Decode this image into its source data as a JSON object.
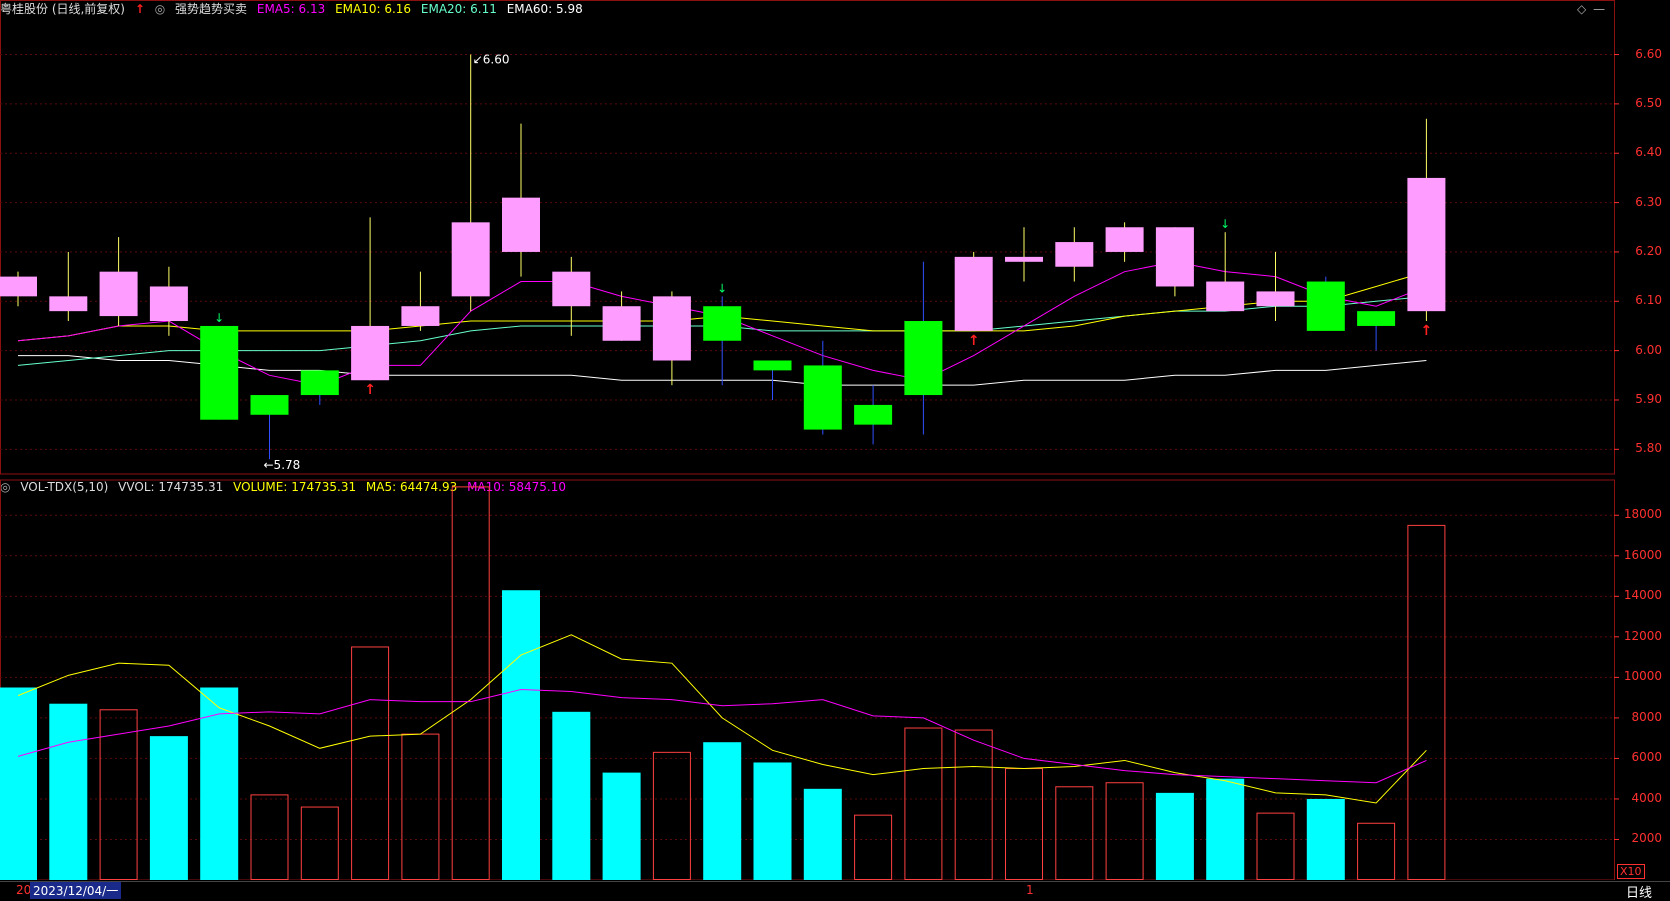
{
  "header": {
    "stock_name": "粤桂股份 (日线,前复权)",
    "indicator_name": "强势趋势买卖",
    "ema5": "EMA5: 6.13",
    "ema10": "EMA10: 6.16",
    "ema20": "EMA20: 6.11",
    "ema60": "EMA60: 5.98",
    "icons": [
      "diamond-icon",
      "minimize-icon",
      "settings-icon"
    ]
  },
  "volume_header": {
    "name": "VOL-TDX(5,10)",
    "vvol": "VVOL: 174735.31",
    "volume": "VOLUME: 174735.31",
    "ma5": "MA5: 64474.93",
    "ma10": "MA10: 58475.10"
  },
  "price_axis": [
    "6.60",
    "6.50",
    "6.40",
    "6.30",
    "6.20",
    "6.10",
    "6.00",
    "5.90",
    "5.80"
  ],
  "volume_axis": [
    "18000",
    "16000",
    "14000",
    "12000",
    "10000",
    "8000",
    "6000",
    "4000",
    "2000"
  ],
  "annotations": {
    "high": "6.60",
    "low": "5.78"
  },
  "volume_unit": "X10",
  "status_bar": {
    "date": "2023/12/04/一",
    "left_fragment": "20",
    "marker": "1",
    "period": "日线"
  },
  "colors": {
    "up": "#ff4040",
    "down": "#00ffff",
    "candle_up": "#ff9cff",
    "candle_down": "#00ff00",
    "ema5": "#ff00ff",
    "ema10": "#ffff00",
    "ema20": "#66ffcc",
    "ema60": "#ffffff"
  },
  "chart_data": {
    "type": "candlestick",
    "ylim": [
      5.75,
      6.67
    ],
    "volume_ylim": [
      0,
      19000
    ],
    "candles": [
      {
        "o": 6.11,
        "h": 6.16,
        "l": 6.09,
        "c": 6.15,
        "up": true
      },
      {
        "o": 6.08,
        "h": 6.2,
        "l": 6.06,
        "c": 6.11,
        "up": true
      },
      {
        "o": 6.07,
        "h": 6.23,
        "l": 6.05,
        "c": 6.16,
        "up": true
      },
      {
        "o": 6.06,
        "h": 6.17,
        "l": 6.03,
        "c": 6.13,
        "up": true
      },
      {
        "o": 6.05,
        "h": 6.05,
        "l": 5.86,
        "c": 5.86,
        "up": false
      },
      {
        "o": 5.91,
        "h": 5.91,
        "l": 5.78,
        "c": 5.87,
        "up": false
      },
      {
        "o": 5.96,
        "h": 5.96,
        "l": 5.89,
        "c": 5.91,
        "up": false
      },
      {
        "o": 5.94,
        "h": 6.27,
        "l": 5.94,
        "c": 6.05,
        "up": true
      },
      {
        "o": 6.05,
        "h": 6.16,
        "l": 6.04,
        "c": 6.09,
        "up": true
      },
      {
        "o": 6.11,
        "h": 6.6,
        "l": 6.08,
        "c": 6.26,
        "up": true
      },
      {
        "o": 6.2,
        "h": 6.46,
        "l": 6.15,
        "c": 6.31,
        "up": true
      },
      {
        "o": 6.09,
        "h": 6.19,
        "l": 6.03,
        "c": 6.16,
        "up": true
      },
      {
        "o": 6.02,
        "h": 6.12,
        "l": 6.02,
        "c": 6.09,
        "up": true
      },
      {
        "o": 5.98,
        "h": 6.12,
        "l": 5.93,
        "c": 6.11,
        "up": true
      },
      {
        "o": 6.09,
        "h": 6.11,
        "l": 5.93,
        "c": 6.02,
        "up": false
      },
      {
        "o": 5.98,
        "h": 5.98,
        "l": 5.9,
        "c": 5.96,
        "up": false
      },
      {
        "o": 5.97,
        "h": 6.02,
        "l": 5.83,
        "c": 5.84,
        "up": false
      },
      {
        "o": 5.89,
        "h": 5.93,
        "l": 5.81,
        "c": 5.85,
        "up": false
      },
      {
        "o": 6.06,
        "h": 6.18,
        "l": 5.83,
        "c": 5.91,
        "up": false
      },
      {
        "o": 6.04,
        "h": 6.2,
        "l": 6.04,
        "c": 6.19,
        "up": true
      },
      {
        "o": 6.18,
        "h": 6.25,
        "l": 6.14,
        "c": 6.19,
        "up": true
      },
      {
        "o": 6.17,
        "h": 6.25,
        "l": 6.14,
        "c": 6.22,
        "up": true
      },
      {
        "o": 6.2,
        "h": 6.26,
        "l": 6.18,
        "c": 6.25,
        "up": true
      },
      {
        "o": 6.13,
        "h": 6.25,
        "l": 6.11,
        "c": 6.25,
        "up": true
      },
      {
        "o": 6.08,
        "h": 6.24,
        "l": 6.08,
        "c": 6.14,
        "up": true
      },
      {
        "o": 6.09,
        "h": 6.2,
        "l": 6.06,
        "c": 6.12,
        "up": true
      },
      {
        "o": 6.14,
        "h": 6.15,
        "l": 6.04,
        "c": 6.04,
        "up": false
      },
      {
        "o": 6.08,
        "h": 6.08,
        "l": 6.0,
        "c": 6.05,
        "up": false
      },
      {
        "o": 6.08,
        "h": 6.47,
        "l": 6.06,
        "c": 6.35,
        "up": true
      }
    ],
    "volume": [
      {
        "v": 9500,
        "up": false
      },
      {
        "v": 8700,
        "up": false
      },
      {
        "v": 8400,
        "up": true
      },
      {
        "v": 7100,
        "up": false
      },
      {
        "v": 9500,
        "up": false
      },
      {
        "v": 4200,
        "up": true
      },
      {
        "v": 3600,
        "up": true
      },
      {
        "v": 11500,
        "up": true
      },
      {
        "v": 7200,
        "up": true
      },
      {
        "v": 19400,
        "up": true
      },
      {
        "v": 14300,
        "up": false
      },
      {
        "v": 8300,
        "up": false
      },
      {
        "v": 5300,
        "up": false
      },
      {
        "v": 6300,
        "up": true
      },
      {
        "v": 6800,
        "up": false
      },
      {
        "v": 5800,
        "up": false
      },
      {
        "v": 4500,
        "up": false
      },
      {
        "v": 3200,
        "up": true
      },
      {
        "v": 7500,
        "up": true
      },
      {
        "v": 7400,
        "up": true
      },
      {
        "v": 5500,
        "up": true
      },
      {
        "v": 4600,
        "up": true
      },
      {
        "v": 4800,
        "up": true
      },
      {
        "v": 4300,
        "up": false
      },
      {
        "v": 5000,
        "up": false
      },
      {
        "v": 3300,
        "up": true
      },
      {
        "v": 4000,
        "up": false
      },
      {
        "v": 2800,
        "up": true
      },
      {
        "v": 17500,
        "up": true
      }
    ],
    "ema5": [
      6.02,
      6.03,
      6.05,
      6.06,
      6.0,
      5.95,
      5.93,
      5.97,
      5.97,
      6.08,
      6.14,
      6.14,
      6.11,
      6.09,
      6.07,
      6.03,
      5.99,
      5.96,
      5.94,
      5.99,
      6.05,
      6.11,
      6.16,
      6.18,
      6.16,
      6.15,
      6.11,
      6.09,
      6.13
    ],
    "ema10": [
      6.02,
      6.03,
      6.05,
      6.05,
      6.04,
      6.04,
      6.04,
      6.04,
      6.05,
      6.06,
      6.06,
      6.06,
      6.06,
      6.06,
      6.07,
      6.06,
      6.05,
      6.04,
      6.04,
      6.04,
      6.04,
      6.05,
      6.07,
      6.08,
      6.09,
      6.1,
      6.1,
      6.13,
      6.16
    ],
    "ema20": [
      5.97,
      5.98,
      5.99,
      6.0,
      6.0,
      6.0,
      6.0,
      6.01,
      6.02,
      6.04,
      6.05,
      6.05,
      6.05,
      6.05,
      6.05,
      6.04,
      6.04,
      6.04,
      6.04,
      6.04,
      6.05,
      6.06,
      6.07,
      6.08,
      6.08,
      6.09,
      6.09,
      6.1,
      6.11
    ],
    "ema60": [
      5.99,
      5.99,
      5.98,
      5.98,
      5.97,
      5.96,
      5.96,
      5.95,
      5.95,
      5.95,
      5.95,
      5.95,
      5.94,
      5.94,
      5.94,
      5.94,
      5.93,
      5.93,
      5.93,
      5.93,
      5.94,
      5.94,
      5.94,
      5.95,
      5.95,
      5.96,
      5.96,
      5.97,
      5.98
    ],
    "vol_ma5": [
      9100,
      10100,
      10700,
      10600,
      8500,
      7600,
      6500,
      7100,
      7200,
      8900,
      11100,
      12100,
      10900,
      10700,
      8000,
      6400,
      5700,
      5200,
      5500,
      5600,
      5500,
      5600,
      5900,
      5300,
      4900,
      4300,
      4200,
      3800,
      6400
    ],
    "vol_ma10": [
      6100,
      6800,
      7200,
      7600,
      8200,
      8300,
      8200,
      8900,
      8800,
      8800,
      9400,
      9300,
      9000,
      8900,
      8600,
      8700,
      8900,
      8100,
      8000,
      6900,
      6000,
      5700,
      5400,
      5200,
      5100,
      5000,
      4900,
      4800,
      5900
    ],
    "signals": [
      {
        "i": 4,
        "type": "buy-green"
      },
      {
        "i": 7,
        "type": "up-red"
      },
      {
        "i": 14,
        "type": "buy-green"
      },
      {
        "i": 19,
        "type": "up-red"
      },
      {
        "i": 24,
        "type": "buy-green-hollow"
      },
      {
        "i": 28,
        "type": "up-red"
      }
    ]
  }
}
